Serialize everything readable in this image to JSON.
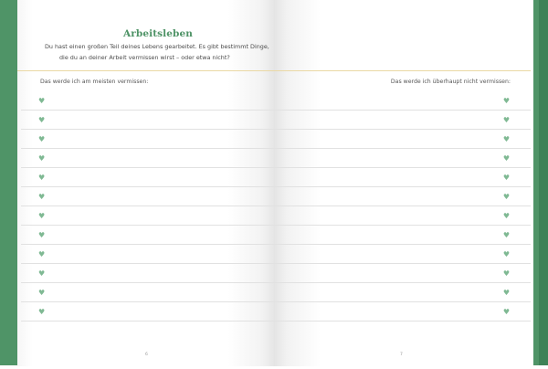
{
  "page": {
    "title": "Arbeitsleben",
    "intro_line1": "Du hast einen großen Teil deines Lebens gearbeitet. Es gibt bestimmt Dinge,",
    "intro_line2": "die du an deiner Arbeit vermissen wirst – oder etwa nicht?",
    "left_column_label": "Das werde ich am meisten vermissen:",
    "right_column_label": "Das werde ich überhaupt nicht vermissen:",
    "page_number_left": "6",
    "page_number_right": "7"
  },
  "rows": [
    {
      "left": "♥",
      "right": "♥"
    },
    {
      "left": "♥",
      "right": "♥"
    },
    {
      "left": "♥",
      "right": "♥"
    },
    {
      "left": "♥",
      "right": "♥"
    },
    {
      "left": "♥",
      "right": "♥"
    },
    {
      "left": "♥",
      "right": "♥"
    },
    {
      "left": "♥",
      "right": "♥"
    },
    {
      "left": "♥",
      "right": "♥"
    },
    {
      "left": "♥",
      "right": "♥"
    },
    {
      "left": "♥",
      "right": "♥"
    },
    {
      "left": "♥",
      "right": "♥"
    },
    {
      "left": "♥",
      "right": "♥"
    }
  ],
  "icons": {
    "bullet": "heart-icon"
  },
  "colors": {
    "accent": "#4e9366",
    "heart": "#7fb993",
    "cover": "#4f9467",
    "divider": "#ead8a4"
  }
}
